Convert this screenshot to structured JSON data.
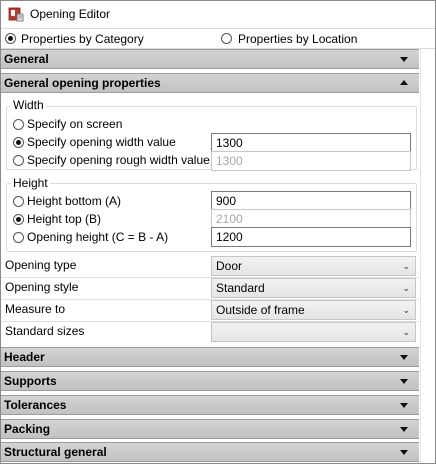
{
  "window": {
    "title": "Opening Editor"
  },
  "view_tabs": {
    "by_category": "Properties by Category",
    "by_location": "Properties by Location",
    "selected": "by_category"
  },
  "sections": {
    "general": "General",
    "general_opening": "General opening properties",
    "header": "Header",
    "supports": "Supports",
    "tolerances": "Tolerances",
    "packing": "Packing",
    "structural_general": "Structural general"
  },
  "width": {
    "group_label": "Width",
    "opt_screen": "Specify on screen",
    "opt_width": "Specify opening width value",
    "opt_rough": "Specify opening rough width value",
    "width_value": "1300",
    "rough_value": "1300"
  },
  "height": {
    "group_label": "Height",
    "opt_bottom": "Height bottom (A)",
    "opt_top": "Height top (B)",
    "opt_opening": "Opening height (C = B - A)",
    "bottom_value": "900",
    "top_value": "2100",
    "opening_value": "1200"
  },
  "props": {
    "opening_type_label": "Opening type",
    "opening_type_value": "Door",
    "opening_style_label": "Opening style",
    "opening_style_value": "Standard",
    "measure_to_label": "Measure to",
    "measure_to_value": "Outside of frame",
    "standard_sizes_label": "Standard sizes",
    "standard_sizes_value": ""
  }
}
